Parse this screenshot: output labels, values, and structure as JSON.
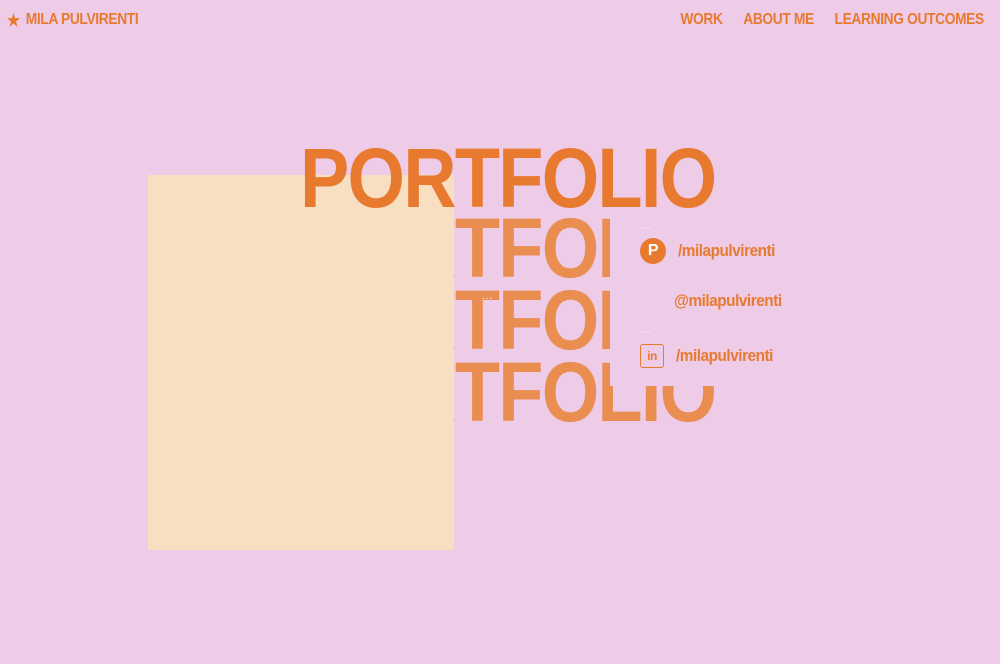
{
  "header": {
    "brand_icon": "star-icon",
    "brand_star": "★",
    "brand_name": "MILA PULVIRENTI",
    "nav": {
      "work": "WORK",
      "about": "ABOUT ME",
      "outcomes": "LEARNING OUTCOMES"
    }
  },
  "hero": {
    "title": "PORTFOLIO",
    "echo_1": "PORTFOLIO",
    "echo_2": "PORTFOLIO",
    "echo_3": "PORTFOLIO"
  },
  "social": {
    "pinterest": {
      "icon": "pinterest-icon",
      "glyph": "P",
      "handle": "/milapulvirenti"
    },
    "instagram": {
      "handle": "@milapulvirenti"
    },
    "linkedin": {
      "icon": "linkedin-icon",
      "glyph": "in",
      "handle": "/milapulvirenti"
    },
    "ellipsis": "..."
  },
  "colors": {
    "background": "#eecbe6",
    "accent": "#e87a30",
    "echo": "#ea8d50",
    "photo_placeholder": "#f8dfc1"
  }
}
